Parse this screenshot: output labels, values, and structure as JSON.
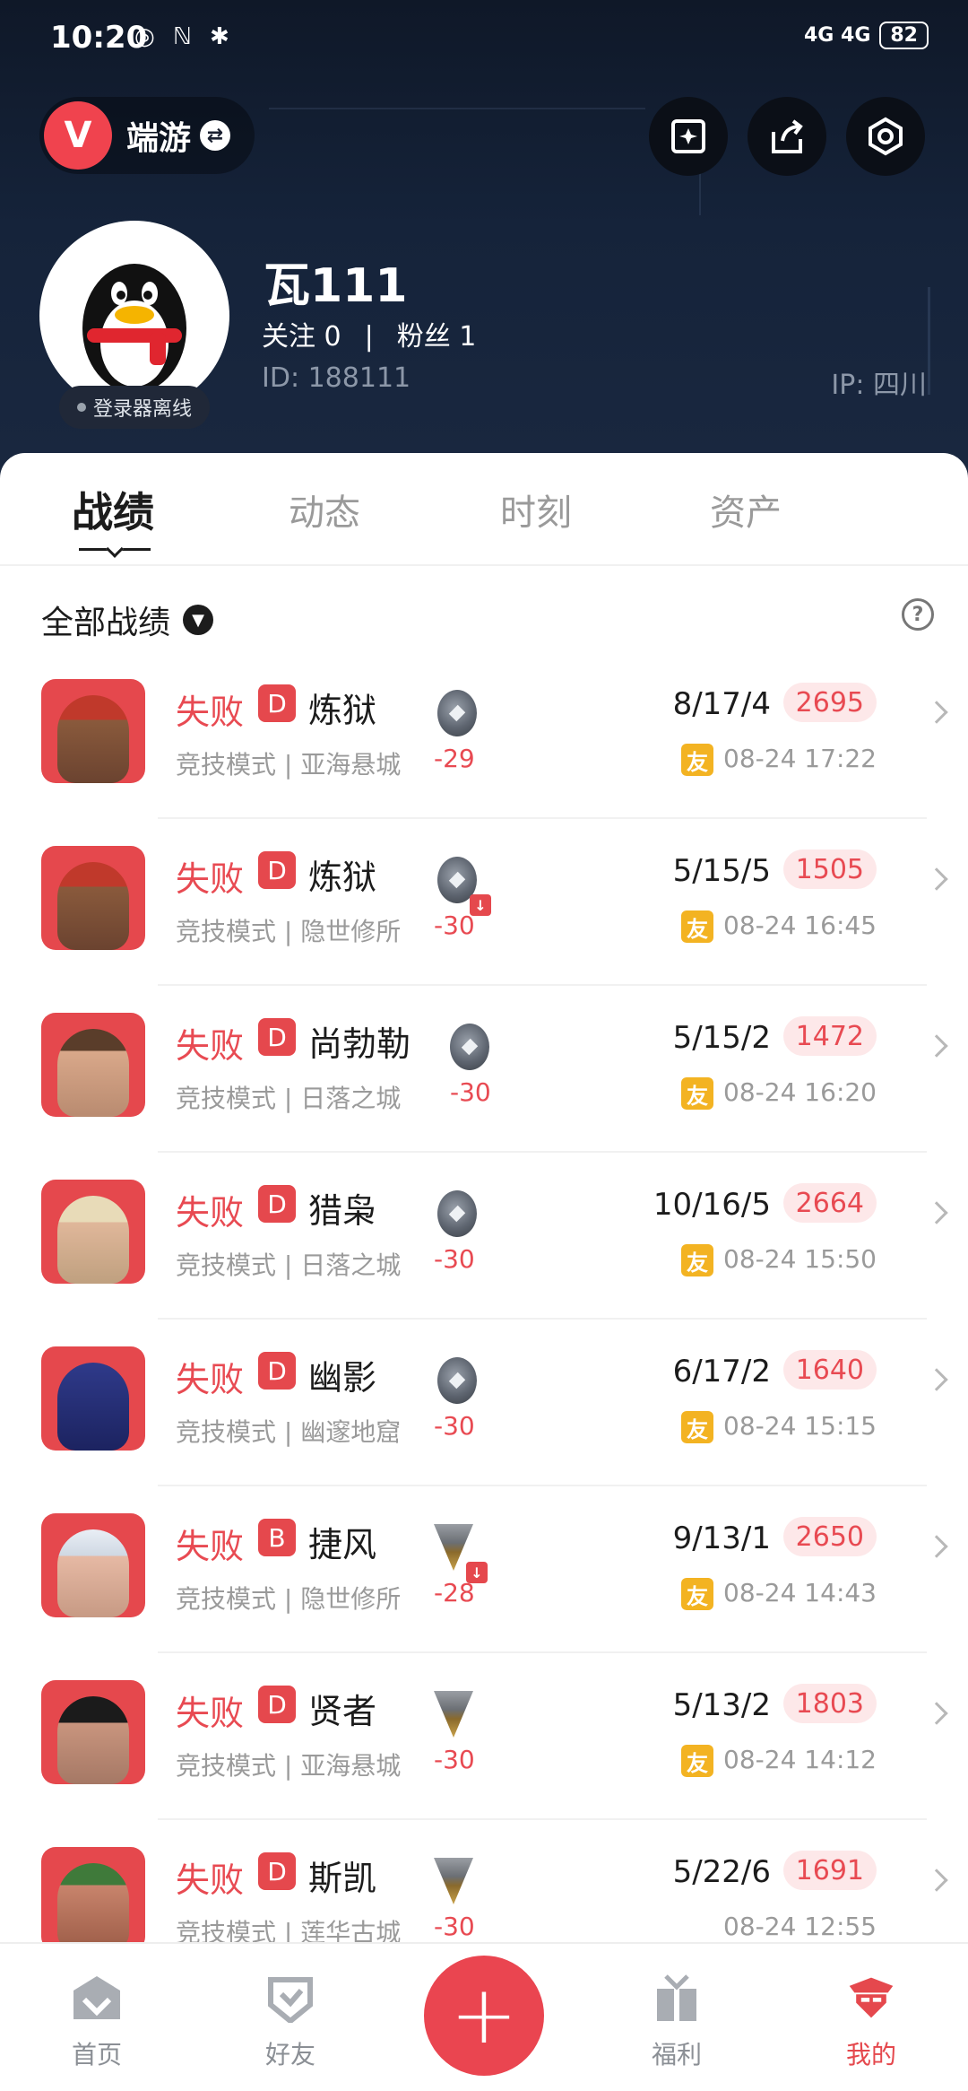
{
  "status_bar": {
    "time": "10:20",
    "left_icons": "◎ ℕ ✱",
    "signal": "4G 4G",
    "battery": "82"
  },
  "header": {
    "game_logo": "V",
    "game_name": "端游",
    "swap_icon": "⇄"
  },
  "profile": {
    "name": "瓦111",
    "follow_label": "关注 0",
    "fans_label": "粉丝 1",
    "separator": "|",
    "id_label": "ID:  188111",
    "ip_label": "IP:  四川",
    "status": "登录器离线"
  },
  "tabs": [
    {
      "label": "战绩",
      "active": true
    },
    {
      "label": "动态",
      "active": false
    },
    {
      "label": "时刻",
      "active": false
    },
    {
      "label": "资产",
      "active": false
    }
  ],
  "filter": {
    "label": "全部战绩",
    "help": "?"
  },
  "matches": [
    {
      "result": "失败",
      "grade": "D",
      "agent": "炼狱",
      "mode_map": "竞技模式 | 亚海悬城",
      "rank": "iron",
      "rank_down": false,
      "delta": "-29",
      "kda": "8/17/4",
      "score": "2695",
      "friend": true,
      "time": "08-24 17:22"
    },
    {
      "result": "失败",
      "grade": "D",
      "agent": "炼狱",
      "mode_map": "竞技模式 | 隐世修所",
      "rank": "iron",
      "rank_down": true,
      "delta": "-30",
      "kda": "5/15/5",
      "score": "1505",
      "friend": true,
      "time": "08-24 16:45"
    },
    {
      "result": "失败",
      "grade": "D",
      "agent": "尚勃勒",
      "mode_map": "竞技模式 | 日落之城",
      "rank": "iron",
      "rank_down": false,
      "delta": "-30",
      "kda": "5/15/2",
      "score": "1472",
      "friend": true,
      "time": "08-24 16:20"
    },
    {
      "result": "失败",
      "grade": "D",
      "agent": "猎枭",
      "mode_map": "竞技模式 | 日落之城",
      "rank": "iron",
      "rank_down": false,
      "delta": "-30",
      "kda": "10/16/5",
      "score": "2664",
      "friend": true,
      "time": "08-24 15:50"
    },
    {
      "result": "失败",
      "grade": "D",
      "agent": "幽影",
      "mode_map": "竞技模式 | 幽邃地窟",
      "rank": "iron",
      "rank_down": false,
      "delta": "-30",
      "kda": "6/17/2",
      "score": "1640",
      "friend": true,
      "time": "08-24 15:15"
    },
    {
      "result": "失败",
      "grade": "B",
      "agent": "捷风",
      "mode_map": "竞技模式 | 隐世修所",
      "rank": "bronze",
      "rank_down": true,
      "delta": "-28",
      "kda": "9/13/1",
      "score": "2650",
      "friend": true,
      "time": "08-24 14:43"
    },
    {
      "result": "失败",
      "grade": "D",
      "agent": "贤者",
      "mode_map": "竞技模式 | 亚海悬城",
      "rank": "bronze",
      "rank_down": false,
      "delta": "-30",
      "kda": "5/13/2",
      "score": "1803",
      "friend": true,
      "time": "08-24 14:12"
    },
    {
      "result": "失败",
      "grade": "D",
      "agent": "斯凯",
      "mode_map": "竞技模式 | 莲华古城",
      "rank": "bronze",
      "rank_down": false,
      "delta": "-30",
      "kda": "5/22/6",
      "score": "1691",
      "friend": false,
      "time": "08-24 12:55"
    }
  ],
  "friend_badge": "友",
  "nav": [
    {
      "label": "首页",
      "icon": "home-icon"
    },
    {
      "label": "好友",
      "icon": "friends-icon"
    },
    {
      "label": "福利",
      "icon": "gift-icon"
    },
    {
      "label": "我的",
      "icon": "profile-icon",
      "active": true
    }
  ],
  "plus": "+",
  "colors": {
    "accent": "#E5484D",
    "header_bg": "#15233A",
    "friend": "#F3B322"
  }
}
